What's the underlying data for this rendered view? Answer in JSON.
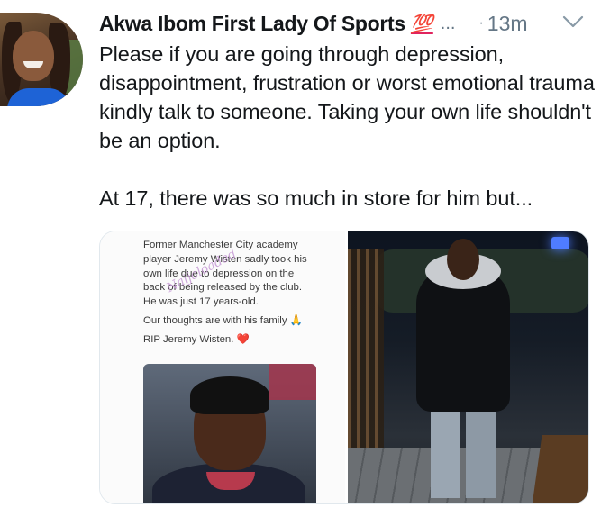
{
  "tweet": {
    "author_name": "Akwa Ibom First Lady Of Sports",
    "author_badge": "💯",
    "truncation": "...",
    "separator": "·",
    "timestamp": "13m",
    "body_paragraphs": [
      "Please if you are going through depression, disappointment, frustration or worst emotional trauma kindly talk to someone. Taking your own life shouldn't be an option.",
      "At 17, there was so much in store for him  but..."
    ]
  },
  "media": {
    "left_image_caption_lines": [
      "Former Manchester City academy",
      "player Jeremy Wisten sadly took his",
      "own life due to depression on the",
      "back of being released by the club.",
      "He was just 17 years-old."
    ],
    "left_image_tribute_line": "Our thoughts are with his family",
    "left_image_pray_emoji": "🙏",
    "left_image_rip_line": "RIP Jeremy Wisten.",
    "left_image_heart_emoji": "❤️",
    "watermark_text": "Naijaloaded"
  },
  "colors": {
    "text_primary": "#14171a",
    "text_secondary": "#657786",
    "badge_red": "#e0245e"
  }
}
